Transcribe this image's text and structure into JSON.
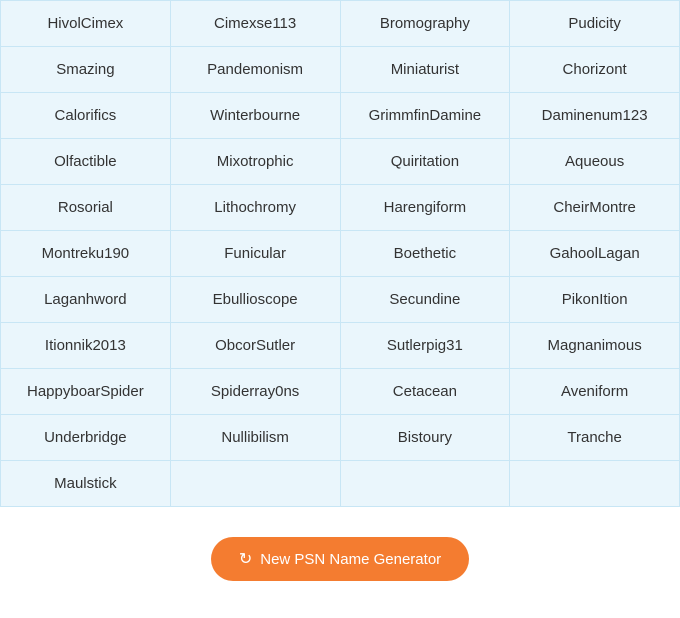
{
  "grid": {
    "cells": [
      "HivolCimex",
      "Cimexse113",
      "Bromography",
      "Pudicity",
      "Smazing",
      "Pandemonism",
      "Miniaturist",
      "Chorizont",
      "Calorifics",
      "Winterbourne",
      "GrimmfinDamine",
      "Daminenum123",
      "Olfactible",
      "Mixotrophic",
      "Quiritation",
      "Aqueous",
      "Rosorial",
      "Lithochromy",
      "Harengiform",
      "CheirMontre",
      "Montreku190",
      "Funicular",
      "Boethetic",
      "GahoolLagan",
      "Laganhword",
      "Ebullioscope",
      "Secundine",
      "PikonItion",
      "Itionnik2013",
      "ObcorSutler",
      "Sutlerpig31",
      "Magnanimous",
      "HappyboarSpider",
      "Spiderray0ns",
      "Cetacean",
      "Aveniform",
      "Underbridge",
      "Nullibilism",
      "Bistoury",
      "Tranche",
      "Maulstick",
      "",
      "",
      ""
    ]
  },
  "button": {
    "label": "New PSN Name Generator",
    "icon": "↻"
  }
}
